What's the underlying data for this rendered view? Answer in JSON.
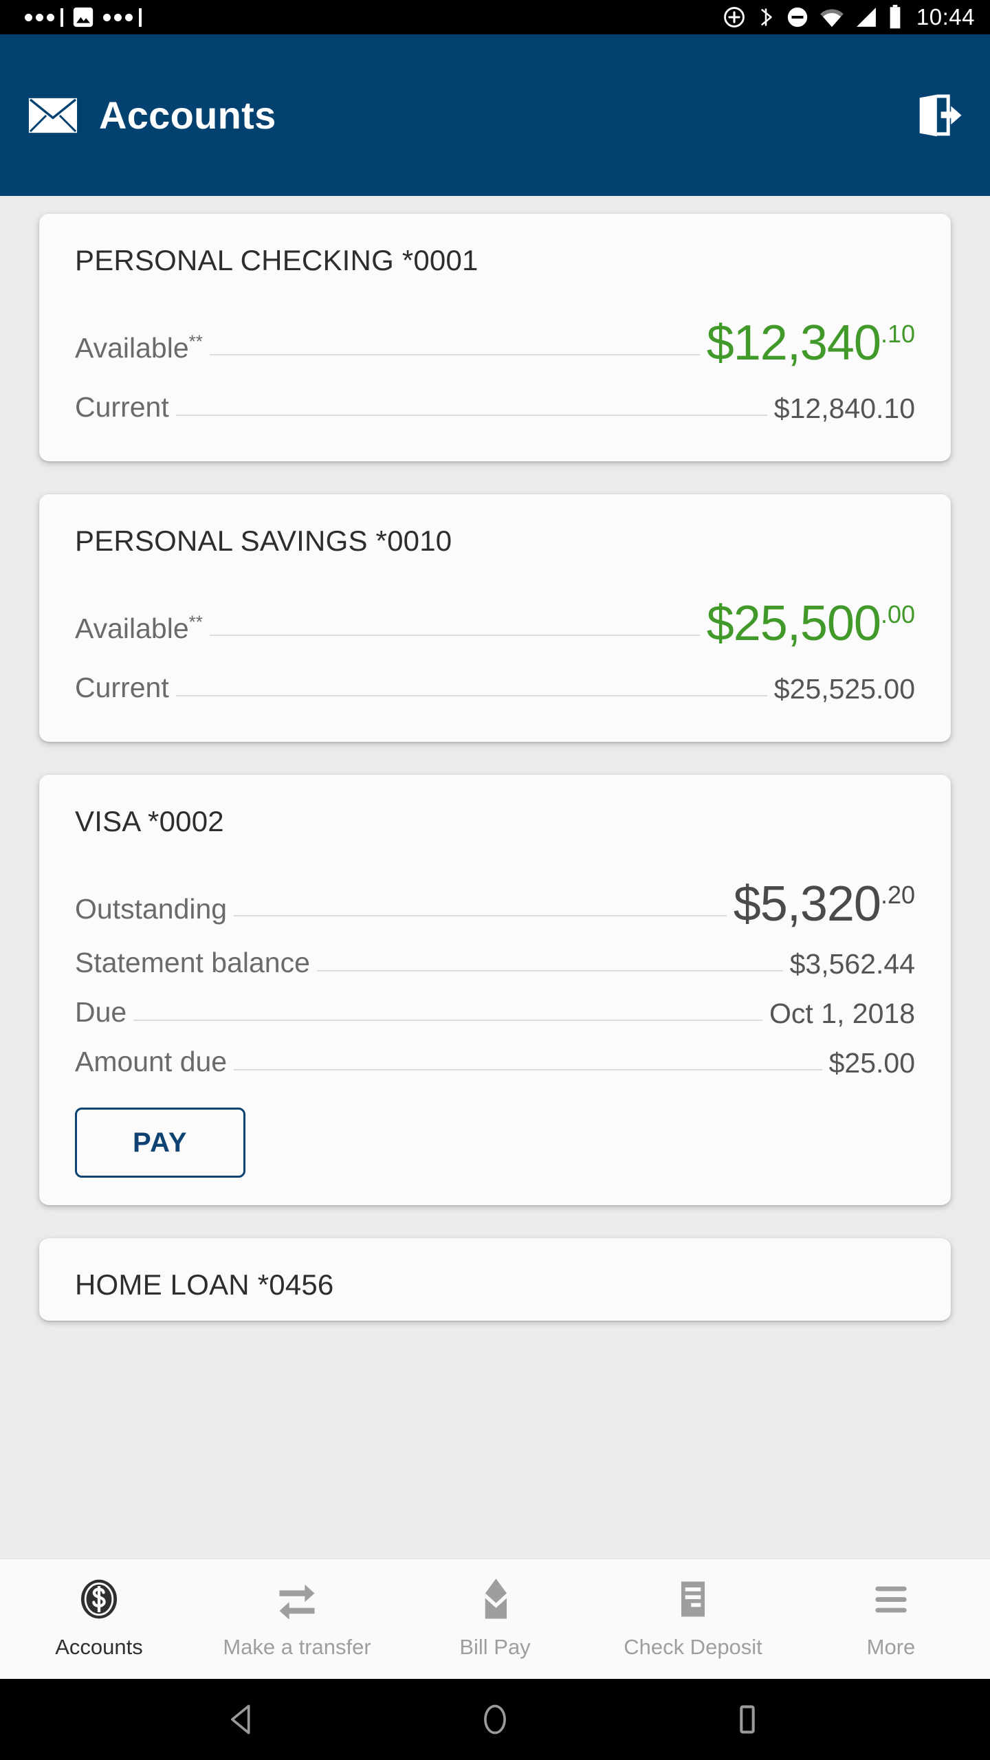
{
  "statusbar": {
    "time": "10:44",
    "left_icons": [
      "dots-indicator-icon",
      "photo-icon",
      "dots-indicator-icon"
    ],
    "right_icons": [
      "add-circle-icon",
      "bluetooth-icon",
      "do-not-disturb-icon",
      "wifi-icon",
      "cellular-signal-icon",
      "battery-icon"
    ]
  },
  "header": {
    "title": "Accounts",
    "mail_icon": "envelope-icon",
    "logout_icon": "logout-icon",
    "background_color": "#034270"
  },
  "colors": {
    "accent_blue": "#034270",
    "positive_green": "#41992a",
    "page_background": "#ebebeb",
    "card_background": "#fbfbfb",
    "label_gray": "#6a6a6a",
    "value_gray": "#555555"
  },
  "accounts": [
    {
      "title": "PERSONAL CHECKING *0001",
      "hero": {
        "label": "Available",
        "label_note": "**",
        "whole": "$12,340",
        "cents": ".10",
        "color": "green"
      },
      "rows": [
        {
          "label": "Current",
          "value": "$12,840.10"
        }
      ],
      "action": null
    },
    {
      "title": "PERSONAL SAVINGS *0010",
      "hero": {
        "label": "Available",
        "label_note": "**",
        "whole": "$25,500",
        "cents": ".00",
        "color": "green"
      },
      "rows": [
        {
          "label": "Current",
          "value": "$25,525.00"
        }
      ],
      "action": null
    },
    {
      "title": "VISA *0002",
      "hero": {
        "label": "Outstanding",
        "label_note": "",
        "whole": "$5,320",
        "cents": ".20",
        "color": "dark"
      },
      "rows": [
        {
          "label": "Statement balance",
          "value": "$3,562.44"
        },
        {
          "label": "Due",
          "value": "Oct 1, 2018"
        },
        {
          "label": "Amount due",
          "value": "$25.00"
        }
      ],
      "action": {
        "label": "PAY"
      }
    }
  ],
  "clipped_account": {
    "title": "HOME LOAN *0456"
  },
  "tabbar": {
    "items": [
      {
        "label": "Accounts",
        "icon": "dollar-coin-icon",
        "active": true
      },
      {
        "label": "Make a transfer",
        "icon": "transfer-arrows-icon",
        "active": false
      },
      {
        "label": "Bill Pay",
        "icon": "bill-envelope-icon",
        "active": false
      },
      {
        "label": "Check Deposit",
        "icon": "check-icon",
        "active": false
      },
      {
        "label": "More",
        "icon": "hamburger-menu-icon",
        "active": false
      }
    ]
  },
  "navbar": {
    "items": [
      {
        "name": "back",
        "icon": "triangle-back-icon"
      },
      {
        "name": "home",
        "icon": "circle-home-icon"
      },
      {
        "name": "recents",
        "icon": "square-recents-icon"
      }
    ]
  }
}
